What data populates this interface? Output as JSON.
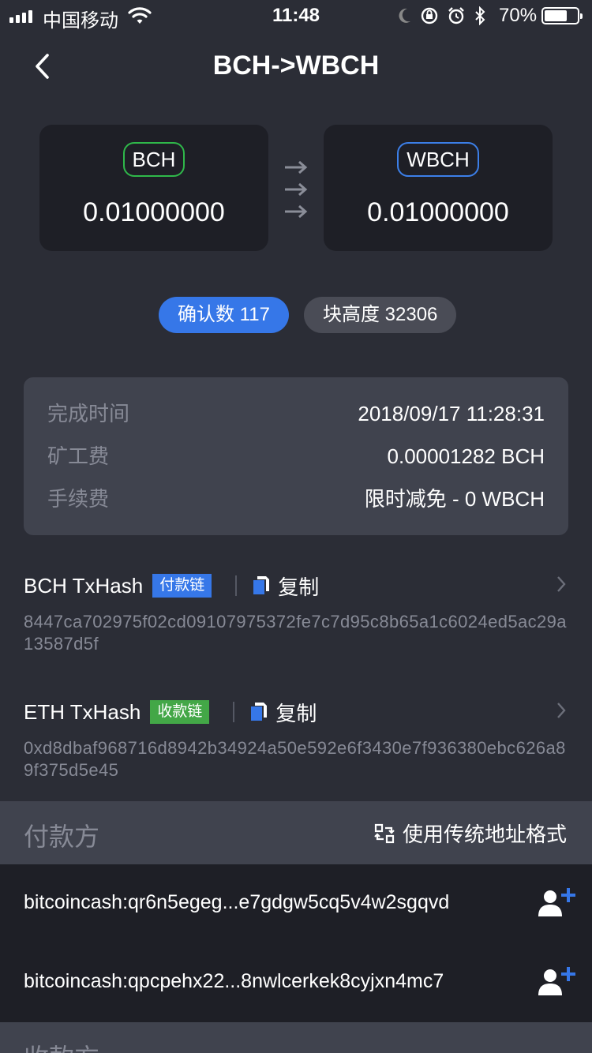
{
  "status_bar": {
    "carrier": "中国移动",
    "time": "11:48",
    "battery": "70%",
    "battery_level": 0.7
  },
  "nav": {
    "title": "BCH->WBCH"
  },
  "swap": {
    "from": {
      "token": "BCH",
      "amount": "0.01000000"
    },
    "to": {
      "token": "WBCH",
      "amount": "0.01000000"
    }
  },
  "pills": {
    "confirmations": "确认数 117",
    "block_height": "块高度 32306"
  },
  "info": {
    "rows": [
      {
        "label": "完成时间",
        "value": "2018/09/17 11:28:31"
      },
      {
        "label": "矿工费",
        "value": "0.00001282 BCH"
      },
      {
        "label": "手续费",
        "value": "限时减免 - 0 WBCH"
      }
    ]
  },
  "tx": [
    {
      "name": "BCH TxHash",
      "tag": "付款链",
      "copy": "复制",
      "hash": "8447ca702975f02cd09107975372fe7c7d95c8b65a1c6024ed5ac29a13587d5f"
    },
    {
      "name": "ETH TxHash",
      "tag": "收款链",
      "copy": "复制",
      "hash": "0xd8dbaf968716d8942b34924a50e592e6f3430e7f936380ebc626a89f375d5e45"
    }
  ],
  "payer": {
    "title": "付款方",
    "format_button": "使用传统地址格式",
    "addresses": [
      "bitcoincash:qr6n5egeg...e7gdgw5cq5v4w2sgqvd",
      "bitcoincash:qpcpehx22...8nwlcerkek8cyjxn4mc7"
    ]
  },
  "payee": {
    "title": "收款方"
  },
  "colors": {
    "background": "#2b2d36",
    "card": "#1e1f26",
    "accent_blue": "#3677e8",
    "accent_green": "#43a747"
  }
}
